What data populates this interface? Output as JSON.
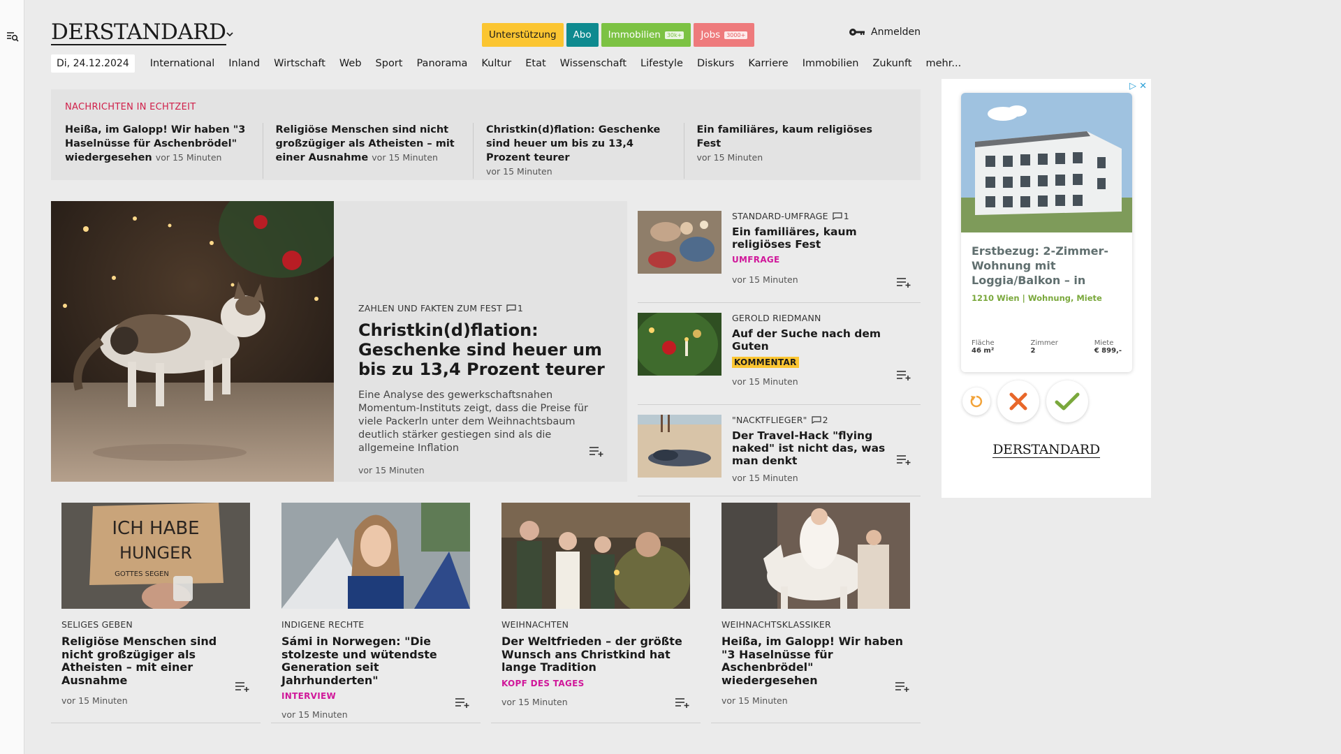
{
  "header": {
    "logo": "DERSTANDARD",
    "pills": [
      {
        "label": "Unterstützung",
        "badge": ""
      },
      {
        "label": "Abo",
        "badge": ""
      },
      {
        "label": "Immobilien",
        "badge": "30k+"
      },
      {
        "label": "Jobs",
        "badge": "3000+"
      }
    ],
    "login_label": "Anmelden"
  },
  "nav": {
    "date": "Di, 24.12.2024",
    "items": [
      "International",
      "Inland",
      "Wirtschaft",
      "Web",
      "Sport",
      "Panorama",
      "Kultur",
      "Etat",
      "Wissenschaft",
      "Lifestyle",
      "Diskurs",
      "Karriere",
      "Immobilien",
      "Zukunft",
      "mehr..."
    ]
  },
  "ticker": {
    "heading": "NACHRICHTEN IN ECHTZEIT",
    "items": [
      {
        "title": "Heißa, im Galopp! Wir haben \"3 Haselnüsse für Aschenbrödel\" wiedergesehen",
        "time": "vor 15 Minuten"
      },
      {
        "title": "Religiöse Menschen sind nicht großzügiger als Atheisten – mit einer Ausnahme",
        "time": "vor 15 Minuten"
      },
      {
        "title": "Christkin(d)flation: Geschenke sind heuer um bis zu 13,4 Prozent teurer",
        "time": "vor 15 Minuten"
      },
      {
        "title": "Ein familiäres, kaum religiöses Fest",
        "time": "vor 15 Minuten"
      }
    ]
  },
  "hero": {
    "kicker": "ZAHLEN UND FAKTEN ZUM FEST",
    "comments": "1",
    "title": "Christkin(d)flation: Geschenke sind heuer um bis zu 13,4 Prozent teurer",
    "lead": "Eine Analyse des gewerkschaftsnahen Momentum-Instituts zeigt, dass die Preise für viele Packerln unter dem Weihnachtsbaum deutlich stärker gestiegen sind als die allgemeine Inflation",
    "time": "vor 15 Minuten"
  },
  "side": [
    {
      "kicker": "STANDARD-UMFRAGE",
      "comments": "1",
      "title": "Ein familiäres, kaum religiöses Fest",
      "label": "UMFRAGE",
      "time": "vor 15 Minuten"
    },
    {
      "kicker": "GEROLD RIEDMANN",
      "comments": "",
      "title": "Auf der Suche nach dem Guten",
      "label": "KOMMENTAR",
      "time": "vor 15 Minuten"
    },
    {
      "kicker": "\"NACKTFLIEGER\"",
      "comments": "2",
      "title": "Der Travel-Hack \"flying naked\" ist nicht das, was man denkt",
      "label": "",
      "time": "vor 15 Minuten"
    }
  ],
  "ad": {
    "title": "Erstbezug: 2-Zimmer-Wohnung mit Loggia/Balkon – in",
    "subtitle": "1210 Wien | Wohnung, Miete",
    "specs": [
      {
        "k": "Fläche",
        "v": "46 m²"
      },
      {
        "k": "Zimmer",
        "v": "2"
      },
      {
        "k": "Miete",
        "v": "€ 899,-"
      }
    ],
    "logo": "DERSTANDARD"
  },
  "cards": [
    {
      "kicker": "SELIGES GEBEN",
      "title": "Religiöse Menschen sind nicht großzügiger als Atheisten – mit einer Ausnahme",
      "label": "",
      "time": "vor 15 Minuten",
      "sign_line1": "ICH HABE",
      "sign_line2": "HUNGER",
      "sign_line3": "GOTTES SEGEN"
    },
    {
      "kicker": "INDIGENE RECHTE",
      "title": "Sámi in Norwegen: \"Die stolzeste und wütendste Generation seit Jahrhunderten\"",
      "label": "INTERVIEW",
      "time": "vor 15 Minuten"
    },
    {
      "kicker": "WEIHNACHTEN",
      "title": "Der Weltfrieden – der größte Wunsch ans Christkind hat lange Tradition",
      "label": "KOPF DES TAGES",
      "time": "vor 15 Minuten"
    },
    {
      "kicker": "WEIHNACHTSKLASSIKER",
      "title": "Heißa, im Galopp! Wir haben \"3 Haselnüsse für Aschenbrödel\" wiedergesehen",
      "label": "",
      "time": "vor 15 Minuten"
    }
  ]
}
